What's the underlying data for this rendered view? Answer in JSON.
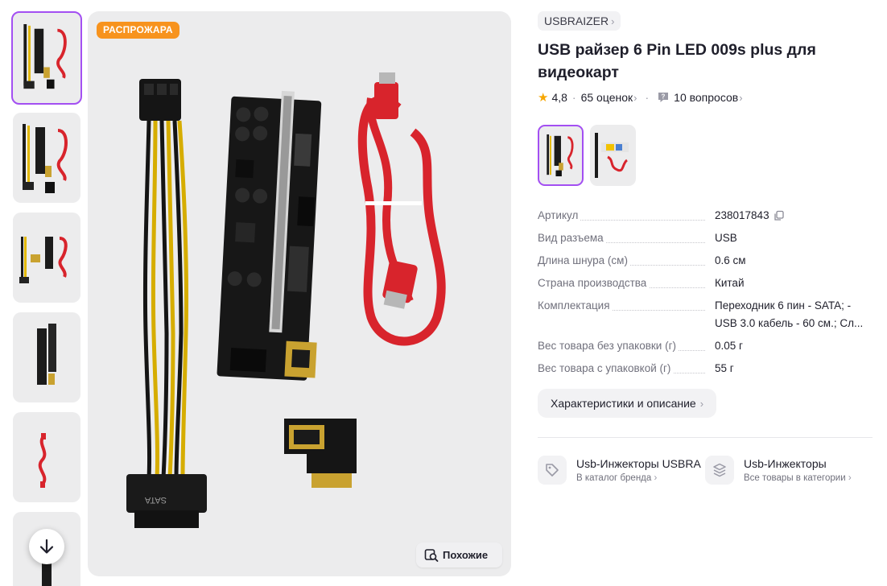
{
  "gallery": {
    "thumbnails": [
      {
        "alt": "thumb-1"
      },
      {
        "alt": "thumb-2"
      },
      {
        "alt": "thumb-3"
      },
      {
        "alt": "thumb-4"
      },
      {
        "alt": "thumb-5"
      },
      {
        "alt": "thumb-6"
      }
    ],
    "sale_badge": "РАСПРОЖАРА",
    "similar_label": "Похожие"
  },
  "product": {
    "brand": "USBRAIZER",
    "title": "USB райзер 6 Pin LED 009s plus для видеокарт",
    "rating": "4,8",
    "reviews": "65 оценок",
    "questions": "10 вопросов"
  },
  "specs": [
    {
      "name": "Артикул",
      "value": "238017843"
    },
    {
      "name": "Вид разъема",
      "value": "USB"
    },
    {
      "name": "Длина шнура (см)",
      "value": "0.6 см"
    },
    {
      "name": "Страна производства",
      "value": "Китай"
    },
    {
      "name": "Комплектация",
      "value": "Переходник 6 пин - SATA; - USB 3.0 кабель - 60 см.; Сл..."
    },
    {
      "name": "Вес товара без упаковки (г)",
      "value": "0.05 г"
    },
    {
      "name": "Вес товара с упаковкой (г)",
      "value": "55 г"
    }
  ],
  "description_button": "Характеристики и описание",
  "links": [
    {
      "title": "Usb-Инжекторы USBRA",
      "subtitle": "В каталог бренда"
    },
    {
      "title": "Usb-Инжекторы",
      "subtitle": "Все товары в категории"
    }
  ],
  "colors": {
    "accent": "#a34ff2",
    "sale": "#f7931e",
    "star": "#f7a600",
    "cable_red": "#d8242c"
  }
}
